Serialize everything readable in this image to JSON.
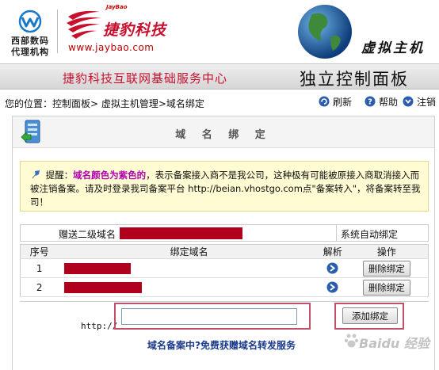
{
  "header": {
    "west_logo_line1": "西部数码",
    "west_logo_line2": "代理机构",
    "jaybao_small": "JayBao",
    "jaybao_name": "捷豹科技",
    "jaybao_url": "www.jaybao.com",
    "vhost_title": "虚拟主机"
  },
  "band": {
    "left_title": "捷豹科技互联网基础服务中心",
    "right_title": "独立控制面板"
  },
  "breadcrumb": "您的位置：控制面板> 虚拟主机管理>域名绑定",
  "toolbar": {
    "refresh_label": "刷新",
    "help_label": "帮助",
    "logout_label": "注销"
  },
  "panel": {
    "title": "域 名 绑 定"
  },
  "notice": {
    "prefix": "提醒：",
    "highlight": "域名颜色为紫色的",
    "body": "，表示备案接入商不是我公司，这种极有可能被原接入商取消接入而被注销备案。请及时登录我司备案平台 http://beian.vhostgo.com点\"备案转入\"，将备案转至我司！"
  },
  "gift_domain": {
    "label": "赠送二级域名",
    "status": "系统自动绑定"
  },
  "table": {
    "headers": {
      "no": "序号",
      "domain": "绑定域名",
      "resolve": "解析",
      "action": "操作"
    },
    "rows": [
      {
        "no": "1",
        "delete_label": "删除绑定"
      },
      {
        "no": "2",
        "delete_label": "删除绑定"
      }
    ]
  },
  "add": {
    "http_label": "http://",
    "input_value": "",
    "button_label": "添加绑定",
    "promo": "域名备案中?免费获赠域名转发服务"
  },
  "watermark": {
    "text": "Baidu 经验"
  },
  "colors": {
    "brand_red": "#c8102e",
    "redacted": "#b0001e",
    "highlight_box": "#c0506a",
    "notice_purple": "#b000b0",
    "promo_blue": "#1a3a8a"
  },
  "icons": [
    "west-logo-icon",
    "jaybao-logo-icon",
    "globe-icon",
    "refresh-icon",
    "help-icon",
    "logout-icon",
    "server-icon",
    "pin-icon",
    "resolve-icon",
    "baidu-paw-icon"
  ]
}
